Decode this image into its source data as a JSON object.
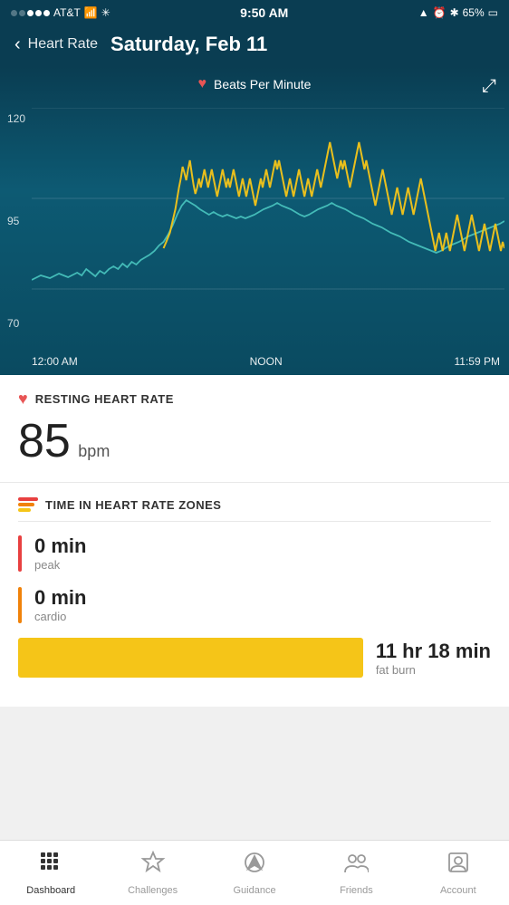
{
  "statusBar": {
    "carrier": "AT&T",
    "time": "9:50 AM",
    "battery": "65%",
    "batteryIcon": "🔋"
  },
  "header": {
    "backLabel": "Heart Rate",
    "title": "Saturday, Feb 11"
  },
  "chart": {
    "legend": "Beats Per Minute",
    "yLabels": [
      "120",
      "95",
      "70"
    ],
    "xLabels": [
      "12:00 AM",
      "NOON",
      "11:59 PM"
    ],
    "expandIcon": "⤢"
  },
  "restingHeartRate": {
    "sectionTitle": "RESTING HEART RATE",
    "value": "85",
    "unit": "bpm"
  },
  "heartRateZones": {
    "sectionTitle": "TIME IN HEART RATE ZONES",
    "zones": [
      {
        "id": "peak",
        "value": "0 min",
        "label": "peak",
        "color": "#e84040"
      },
      {
        "id": "cardio",
        "value": "0 min",
        "label": "cardio",
        "color": "#f0820a"
      },
      {
        "id": "fatburn",
        "value": "11 hr 18 min",
        "label": "fat burn",
        "color": "#f5c518"
      }
    ]
  },
  "bottomNav": {
    "items": [
      {
        "id": "dashboard",
        "label": "Dashboard",
        "active": true
      },
      {
        "id": "challenges",
        "label": "Challenges",
        "active": false
      },
      {
        "id": "guidance",
        "label": "Guidance",
        "active": false
      },
      {
        "id": "friends",
        "label": "Friends",
        "active": false
      },
      {
        "id": "account",
        "label": "Account",
        "active": false
      }
    ]
  }
}
